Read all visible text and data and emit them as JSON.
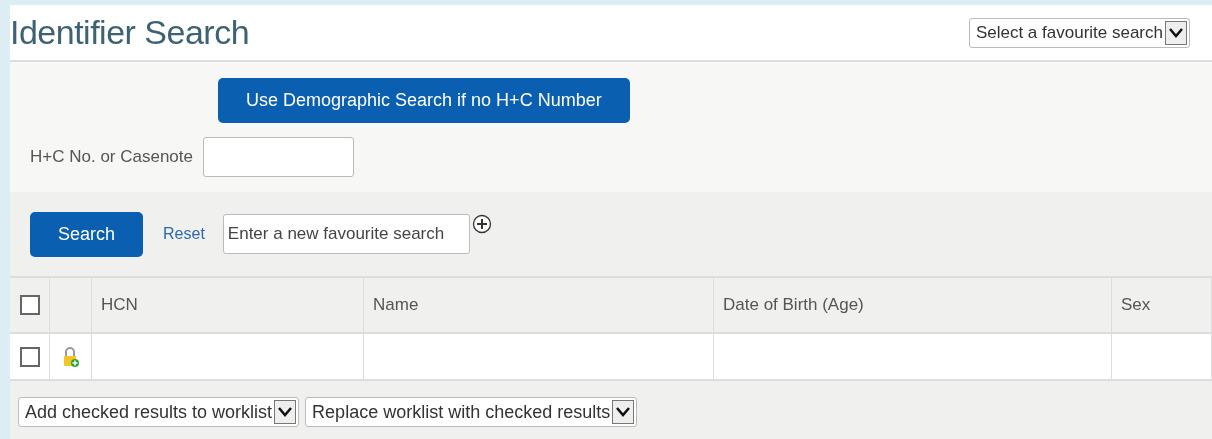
{
  "page": {
    "title": "Identifier Search"
  },
  "favourite_select": {
    "value": "Select a favourite search"
  },
  "demographic_button": {
    "label": "Use Demographic Search if no H+C Number"
  },
  "hcn_field": {
    "label": "H+C No. or Casenote"
  },
  "actions": {
    "search": "Search",
    "reset": "Reset",
    "favourite_name": {
      "placeholder": "Enter a new favourite search"
    }
  },
  "table": {
    "select_all": {
      "checked": false
    },
    "columns": [
      "HCN",
      "Name",
      "Date of Birth (Age)",
      "Sex"
    ],
    "rows": [
      {
        "checked": false,
        "locked": true
      }
    ]
  },
  "footer_selects": [
    "Add checked results to worklist",
    "Replace worklist with checked results"
  ]
}
